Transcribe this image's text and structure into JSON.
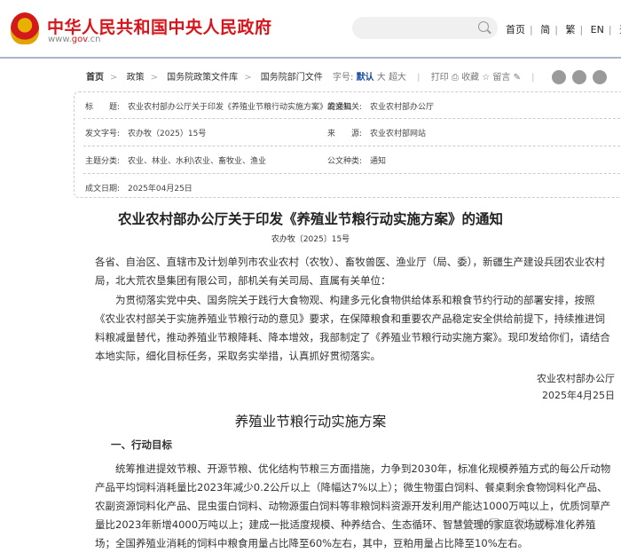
{
  "header": {
    "site_title": "中华人民共和国中央人民政府",
    "site_url_prefix": "www.",
    "site_url_mid": "gov",
    "site_url_suffix": ".cn",
    "search_placeholder": "",
    "nav": [
      "首页",
      "简",
      "繁",
      "EN",
      "登录"
    ]
  },
  "breadcrumb": [
    "首页",
    "政策",
    "国务院政策文件库",
    "国务院部门文件"
  ],
  "tools": {
    "font_label": "字号:",
    "font_default": "默认",
    "font_large": "大",
    "font_xlarge": "超大",
    "print": "打印",
    "favorite": "收藏",
    "comment": "留言"
  },
  "info": {
    "title_label": "标　　题:",
    "title": "农业农村部办公厅关于印发《养殖业节粮行动实施方案》的通知",
    "issuer_label": "发文机关:",
    "issuer": "农业农村部办公厅",
    "docno_label": "发文字号:",
    "docno": "农办牧（2025）15号",
    "source_label": "来　　源:",
    "source": "农业农村部网站",
    "topic_label": "主题分类:",
    "topic": "农业、林业、水利\\农业、畜牧业、渔业",
    "type_label": "公文种类:",
    "type": "通知",
    "date_label": "成文日期:",
    "date": "2025年04月25日"
  },
  "doc": {
    "title": "农业农村部办公厅关于印发《养殖业节粮行动实施方案》的通知",
    "docno": "农办牧〔2025〕15号",
    "addressees": "各省、自治区、直辖市及计划单列市农业农村（农牧）、畜牧兽医、渔业厅（局、委），新疆生产建设兵团农业农村局，北大荒农垦集团有限公司，部机关有关司局、直属有关单位：",
    "para1": "为贯彻落实党中央、国务院关于践行大食物观、构建多元化食物供给体系和粮食节约行动的部署安排，按照《农业农村部关于实施养殖业节粮行动的意见》要求，在保障粮食和重要农产品稳定安全供给前提下，持续推进饲料粮减量替代，推动养殖业节粮降耗、降本增效，我部制定了《养殖业节粮行动实施方案》。现印发给你们，请结合本地实际，细化目标任务，采取务实举措，认真抓好贯彻落实。",
    "signer": "农业农村部办公厅",
    "sign_date": "2025年4月25日",
    "plan_title": "养殖业节粮行动实施方案",
    "section1": "一、行动目标",
    "para2": "统筹推进提效节粮、开源节粮、优化结构节粮三方面措施，力争到2030年，标准化规模养殖方式的每公斤动物产品平均饲料消耗量比2023年减少0.2公斤以上（降幅达7%以上）；微生物蛋白饲料、餐桌剩余食物饲料化产品、农副资源饲料化产品、昆虫蛋白饲料、动物源蛋白饲料等非粮饲料资源开发利用产能达1000万吨以上，优质饲草产量比2023年新增4000万吨以上；建成一批适度规模、种养结合、生态循环、智慧管理的家庭农场或标准化养殖场；全国养殖业消耗的饲料中粮食用量占比降至60%左右，其中，豆粕用量占比降至10%左右。"
  },
  "watermark": "公众号 · 新枝网"
}
